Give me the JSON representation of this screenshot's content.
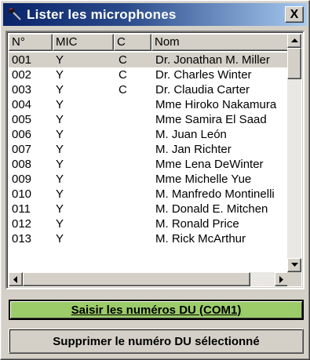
{
  "window": {
    "title": "Lister les microphones",
    "close_label": "X"
  },
  "table": {
    "columns": [
      "N°",
      "MIC",
      "C",
      "Nom"
    ],
    "rows": [
      {
        "n": "001",
        "mic": "Y",
        "c": "C",
        "nom": "Dr. Jonathan M. Miller",
        "selected": true
      },
      {
        "n": "002",
        "mic": "Y",
        "c": "C",
        "nom": "Dr. Charles Winter"
      },
      {
        "n": "003",
        "mic": "Y",
        "c": "C",
        "nom": "Dr. Claudia Carter"
      },
      {
        "n": "004",
        "mic": "Y",
        "c": "",
        "nom": "Mme Hiroko Nakamura"
      },
      {
        "n": "005",
        "mic": "Y",
        "c": "",
        "nom": "Mme Samira El Saad"
      },
      {
        "n": "006",
        "mic": "Y",
        "c": "",
        "nom": "M. Juan León"
      },
      {
        "n": "007",
        "mic": "Y",
        "c": "",
        "nom": "M. Jan Richter"
      },
      {
        "n": "008",
        "mic": "Y",
        "c": "",
        "nom": "Mme Lena DeWinter"
      },
      {
        "n": "009",
        "mic": "Y",
        "c": "",
        "nom": "Mme Michelle Yue"
      },
      {
        "n": "010",
        "mic": "Y",
        "c": "",
        "nom": "M. Manfredo Montinelli"
      },
      {
        "n": "011",
        "mic": "Y",
        "c": "",
        "nom": "M. Donald E. Mitchen"
      },
      {
        "n": "012",
        "mic": "Y",
        "c": "",
        "nom": "M. Ronald Price"
      },
      {
        "n": "013",
        "mic": "Y",
        "c": "",
        "nom": "M. Rick McArthur"
      }
    ]
  },
  "buttons": {
    "com_label": "Saisir les numéros DU (COM1)",
    "delete_label": "Supprimer le numéro DU sélectionné"
  },
  "colors": {
    "titlebar": "#0a246a",
    "com_button": "#99cc66",
    "face": "#d4d0c8"
  }
}
